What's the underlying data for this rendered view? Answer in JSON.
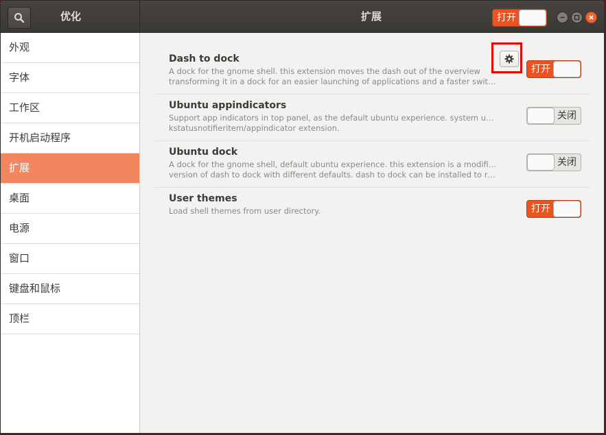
{
  "header": {
    "app_title": "优化",
    "page_title": "扩展",
    "master_switch": {
      "label": "打开",
      "state": "on"
    }
  },
  "sidebar": {
    "items": [
      {
        "label": "外观"
      },
      {
        "label": "字体"
      },
      {
        "label": "工作区"
      },
      {
        "label": "开机启动程序"
      },
      {
        "label": "扩展",
        "active": true
      },
      {
        "label": "桌面"
      },
      {
        "label": "电源"
      },
      {
        "label": "窗口"
      },
      {
        "label": "键盘和鼠标"
      },
      {
        "label": "顶栏"
      }
    ]
  },
  "extensions": [
    {
      "name": "Dash to dock",
      "desc_line1": "A dock for the gnome shell. this extension moves the dash out of the overview",
      "desc_line2": "transforming it in a dock for an easier launching of applications and a faster swit…",
      "has_settings": true,
      "switch": {
        "label": "打开",
        "state": "on"
      }
    },
    {
      "name": "Ubuntu appindicators",
      "desc_line1": "Support app indicators in top panel, as the default ubuntu experience. system update of",
      "desc_line2": "kstatusnotifieritem/appindicator extension.",
      "has_settings": false,
      "switch": {
        "label": "关闭",
        "state": "off"
      }
    },
    {
      "name": "Ubuntu dock",
      "desc_line1": "A dock for the gnome shell, default ubuntu experience. this extension is a modified",
      "desc_line2": "version of dash to dock with different defaults. dash to dock can be installed to replace i…",
      "has_settings": false,
      "switch": {
        "label": "关闭",
        "state": "off"
      }
    },
    {
      "name": "User themes",
      "desc_line1": "Load shell themes from user directory.",
      "desc_line2": "",
      "has_settings": false,
      "switch": {
        "label": "打开",
        "state": "on"
      }
    }
  ],
  "colors": {
    "accent": "#e95420",
    "sidebar_active": "#f2875f",
    "highlight_box": "#e20000"
  },
  "icons": {
    "search": "search-icon",
    "settings": "gear-icon",
    "minimize": "minimize-icon",
    "maximize": "maximize-icon",
    "close": "close-icon"
  }
}
